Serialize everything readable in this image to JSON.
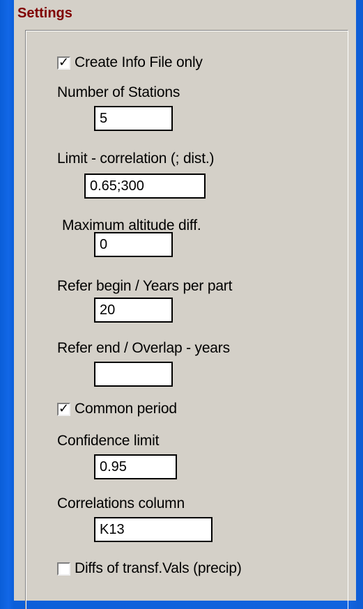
{
  "panel": {
    "title": "Settings"
  },
  "settings": {
    "create_info_file_only": {
      "label": "Create Info File only",
      "checked": true,
      "mark": "✓"
    },
    "number_of_stations": {
      "label": "Number of Stations",
      "value": "5"
    },
    "limit_correlation": {
      "label": "Limit - correlation (; dist.)",
      "value": "0.65;300"
    },
    "max_altitude_diff": {
      "label": "Maximum altitude diff.",
      "value": "0"
    },
    "refer_begin": {
      "label": "Refer begin / Years per part",
      "value": "20"
    },
    "refer_end": {
      "label": "Refer end / Overlap - years",
      "value": ""
    },
    "common_period": {
      "label": "Common period",
      "checked": true,
      "mark": "✓"
    },
    "confidence_limit": {
      "label": "Confidence limit",
      "value": "0.95"
    },
    "correlations_column": {
      "label": "Correlations column",
      "value": "K13"
    },
    "diffs_transf_vals": {
      "label": "Diffs of transf.Vals (precip)",
      "checked": false,
      "mark": ""
    }
  }
}
